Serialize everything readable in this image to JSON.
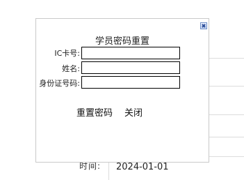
{
  "background": {
    "time_label": "时间:",
    "time_value": "2024-01-01"
  },
  "dialog": {
    "title": "学员密码重置",
    "fields": [
      {
        "label": "IC卡号:",
        "value": ""
      },
      {
        "label": "姓名:",
        "value": ""
      },
      {
        "label": "身份证号码:",
        "value": ""
      }
    ],
    "actions": {
      "reset": "重置密码",
      "close": "关闭"
    }
  }
}
